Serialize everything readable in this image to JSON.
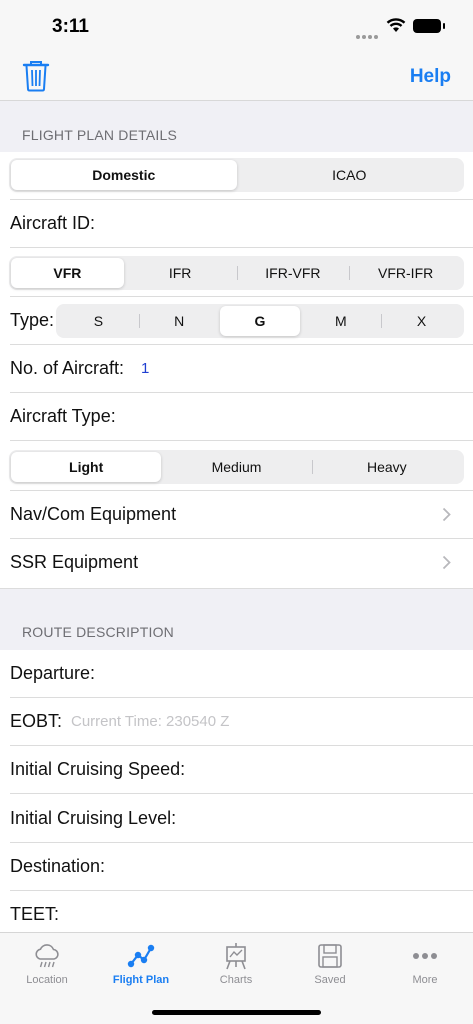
{
  "status": {
    "time": "3:11"
  },
  "nav": {
    "help_label": "Help"
  },
  "flight_plan_section": {
    "header": "FLIGHT PLAN DETAILS",
    "plan_type": {
      "options": [
        "Domestic",
        "ICAO"
      ],
      "selected": "Domestic"
    },
    "aircraft_id_label": "Aircraft ID:",
    "rules": {
      "options": [
        "VFR",
        "IFR",
        "IFR-VFR",
        "VFR-IFR"
      ],
      "selected": "VFR"
    },
    "type_label": "Type:",
    "type": {
      "options": [
        "S",
        "N",
        "G",
        "M",
        "X"
      ],
      "selected": "G"
    },
    "num_aircraft_label": "No. of Aircraft:",
    "num_aircraft_value": "1",
    "aircraft_type_label": "Aircraft Type:",
    "wake": {
      "options": [
        "Light",
        "Medium",
        "Heavy"
      ],
      "selected": "Light"
    },
    "nav_com_label": "Nav/Com Equipment",
    "ssr_label": "SSR Equipment"
  },
  "route_section": {
    "header": "ROUTE DESCRIPTION",
    "departure_label": "Departure:",
    "eobt_label": "EOBT:",
    "eobt_placeholder": "Current Time: 230540 Z",
    "cruise_speed_label": "Initial Cruising Speed:",
    "cruise_level_label": "Initial Cruising Level:",
    "destination_label": "Destination:",
    "teet_label": "TEET:"
  },
  "tabs": [
    {
      "label": "Location",
      "icon": "cloud-rain-icon"
    },
    {
      "label": "Flight Plan",
      "icon": "route-icon"
    },
    {
      "label": "Charts",
      "icon": "easel-icon"
    },
    {
      "label": "Saved",
      "icon": "floppy-disk-icon"
    },
    {
      "label": "More",
      "icon": "ellipsis-icon"
    }
  ],
  "active_tab": "Flight Plan",
  "colors": {
    "accent": "#1a7ef2",
    "value_blue": "#1f3fd1",
    "placeholder": "#c4c4c7"
  }
}
